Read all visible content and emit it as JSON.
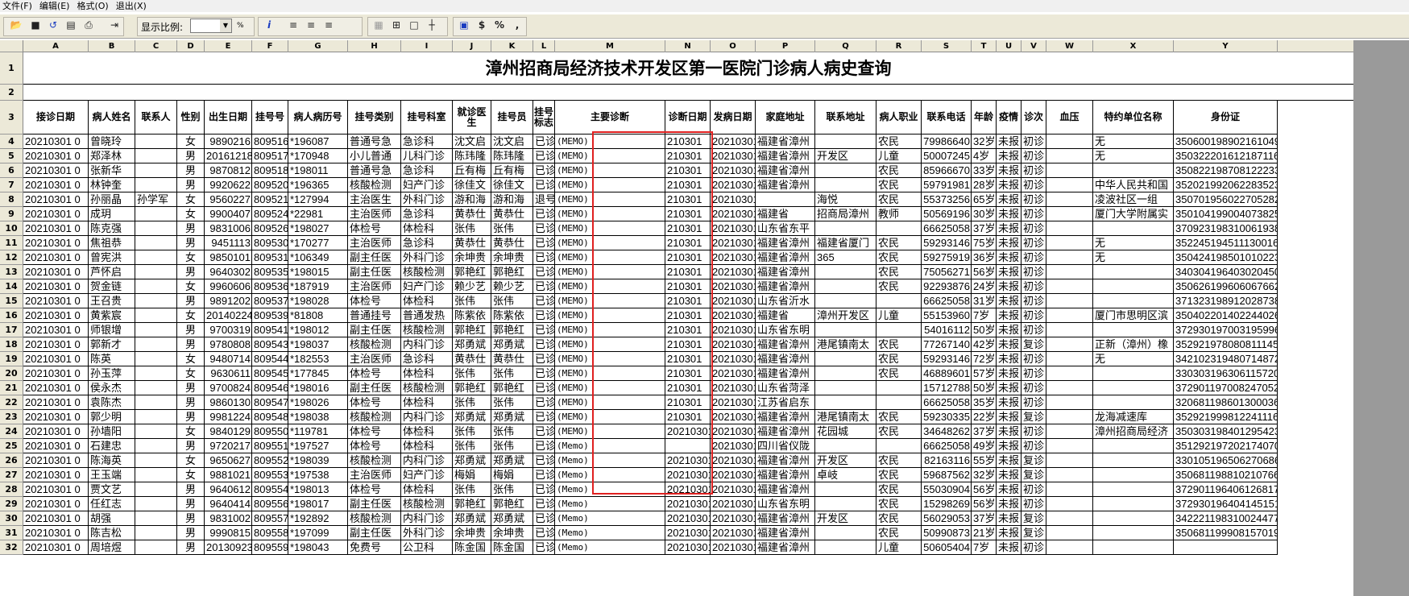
{
  "menu": [
    "文件(F)",
    "编辑(E)",
    "格式(O)",
    "退出(X)"
  ],
  "toolbar": {
    "zoom_label": "显示比例:",
    "zoom_value": "",
    "pct": "%",
    "info": "i",
    "dollar": "$",
    "percent": "%",
    "comma": ","
  },
  "columns": [
    "A",
    "B",
    "C",
    "D",
    "E",
    "F",
    "G",
    "H",
    "I",
    "J",
    "K",
    "L",
    "M",
    "N",
    "O",
    "P",
    "Q",
    "R",
    "S",
    "T",
    "U",
    "V",
    "W",
    "X",
    "Y"
  ],
  "title": "漳州招商局经济技术开发区第一医院门诊病人病史查询",
  "headers": [
    "接诊日期",
    "病人姓名",
    "联系人",
    "性别",
    "出生日期",
    "挂号号",
    "病人病历号",
    "挂号类别",
    "挂号科室",
    "就诊医生",
    "挂号员",
    "挂号标志",
    "主要诊断",
    "诊断日期",
    "发病日期",
    "家庭地址",
    "联系地址",
    "病人职业",
    "联系电话",
    "年龄",
    "疫情",
    "诊次",
    "血压",
    "特约单位名称",
    "身份证"
  ],
  "colors": {
    "highlight": "#e02020",
    "header_bg": "#ece9d8",
    "scroll": "#9a9a9a"
  },
  "rows": [
    [
      "4",
      "20210301 0",
      "曾晓玲",
      "",
      "女",
      "9890216",
      "809516",
      "*196087",
      "普通号急",
      "急诊科",
      "沈文启",
      "沈文启",
      "已诊",
      "(MEMO)",
      "210301",
      "20210301",
      "福建省漳州",
      "",
      "农民",
      "79986640",
      "32岁",
      "未报",
      "初诊",
      "",
      "无",
      "3506001989021610491"
    ],
    [
      "5",
      "20210301 0",
      "郑泽林",
      "",
      "男",
      "20161218",
      "809517",
      "*170948",
      "小儿普通",
      "儿科门诊",
      "陈玮隆",
      "陈玮隆",
      "已诊",
      "(MEMO)",
      "210301",
      "20210301",
      "福建省漳州",
      "开发区",
      "儿童",
      "50007245",
      "4岁",
      "未报",
      "初诊",
      "",
      "无",
      "350322201612187116"
    ],
    [
      "6",
      "20210301 0",
      "张新华",
      "",
      "男",
      "9870812",
      "809518",
      "*198011",
      "普通号急",
      "急诊科",
      "丘有梅",
      "丘有梅",
      "已诊",
      "(MEMO)",
      "210301",
      "20210301",
      "福建省漳州",
      "",
      "农民",
      "85966670",
      "33岁",
      "未报",
      "初诊",
      "",
      "",
      "350822198708122233"
    ],
    [
      "7",
      "20210301 0",
      "林钟奎",
      "",
      "男",
      "9920622",
      "809520",
      "*196365",
      "核酸检测",
      "妇产门诊",
      "徐佳文",
      "徐佳文",
      "已诊",
      "(MEMO)",
      "210301",
      "20210301",
      "福建省漳州",
      "",
      "农民",
      "59791981",
      "28岁",
      "未报",
      "初诊",
      "",
      "中华人民共和国",
      "352021992062283523"
    ],
    [
      "8",
      "20210301 0",
      "孙丽晶",
      "孙学军",
      "女",
      "9560227",
      "809521",
      "*127994",
      "主治医生",
      "外科门诊",
      "游和海",
      "游和海",
      "退号",
      "(MEMO)",
      "210301",
      "20210301",
      "",
      "海悦",
      "农民",
      "55373256",
      "65岁",
      "未报",
      "初诊",
      "",
      "凌波社区一组",
      "350701956022705282"
    ],
    [
      "9",
      "20210301 0",
      "成玥",
      "",
      "女",
      "9900407",
      "809524",
      "*22981",
      "主治医师",
      "急诊科",
      "黄恭仕",
      "黄恭仕",
      "已诊",
      "(MEMO)",
      "210301",
      "20210301",
      "福建省",
      "招商局漳州",
      "教师",
      "50569196",
      "30岁",
      "未报",
      "初诊",
      "",
      "厦门大学附属实",
      "350104199004073825"
    ],
    [
      "10",
      "20210301 0",
      "陈克强",
      "",
      "男",
      "9831006",
      "809526",
      "*198027",
      "体检号",
      "体检科",
      "张伟",
      "张伟",
      "已诊",
      "(MEMO)",
      "210301",
      "20210301",
      "山东省东平",
      "",
      "",
      "66625058",
      "37岁",
      "未报",
      "初诊",
      "",
      "",
      "370923198310061938"
    ],
    [
      "11",
      "20210301 0",
      "焦祖恭",
      "",
      "男",
      "9451113",
      "809530",
      "*170277",
      "主治医师",
      "急诊科",
      "黄恭仕",
      "黄恭仕",
      "已诊",
      "(MEMO)",
      "210301",
      "20210301",
      "福建省漳州",
      "福建省厦门",
      "农民",
      "59293146",
      "75岁",
      "未报",
      "初诊",
      "",
      "无",
      "352245194511130016"
    ],
    [
      "12",
      "20210301 0",
      "曾宪洪",
      "",
      "女",
      "9850101",
      "809531",
      "*106349",
      "副主任医",
      "外科门诊",
      "余坤贵",
      "余坤贵",
      "已诊",
      "(MEMO)",
      "210301",
      "20210301",
      "福建省漳州",
      "365",
      "农民",
      "59275919",
      "36岁",
      "未报",
      "初诊",
      "",
      "无",
      "350424198501010223"
    ],
    [
      "13",
      "20210301 0",
      "芦怀启",
      "",
      "男",
      "9640302",
      "809535",
      "*198015",
      "副主任医",
      "核酸检测",
      "郭艳红",
      "郭艳红",
      "已诊",
      "(MEMO)",
      "210301",
      "20210301",
      "福建省漳州",
      "",
      "农民",
      "75056271",
      "56岁",
      "未报",
      "初诊",
      "",
      "",
      "340304196403020450"
    ],
    [
      "14",
      "20210301 0",
      "贺金链",
      "",
      "女",
      "9960606",
      "809536",
      "*187919",
      "主治医师",
      "妇产门诊",
      "赖少艺",
      "赖少艺",
      "已诊",
      "(MEMO)",
      "210301",
      "20210301",
      "福建省漳州",
      "",
      "农民",
      "92293876",
      "24岁",
      "未报",
      "初诊",
      "",
      "",
      "350626199606067662"
    ],
    [
      "15",
      "20210301 0",
      "王召贵",
      "",
      "男",
      "9891202",
      "809537",
      "*198028",
      "体检号",
      "体检科",
      "张伟",
      "张伟",
      "已诊",
      "(MEMO)",
      "210301",
      "20210301",
      "山东省沂水",
      "",
      "",
      "66625058",
      "31岁",
      "未报",
      "初诊",
      "",
      "",
      "371323198912028738"
    ],
    [
      "16",
      "20210301 0",
      "黄紫宸",
      "",
      "女",
      "20140224",
      "809539",
      "*81808",
      "普通挂号",
      "普通发热",
      "陈紫依",
      "陈紫依",
      "已诊",
      "(MEMO)",
      "210301",
      "20210301",
      "福建省",
      "漳州开发区",
      "儿童",
      "55153960",
      "7岁",
      "未报",
      "初诊",
      "",
      "厦门市思明区滨",
      "350402201402244026"
    ],
    [
      "17",
      "20210301 0",
      "师银增",
      "",
      "男",
      "9700319",
      "809541",
      "*198012",
      "副主任医",
      "核酸检测",
      "郭艳红",
      "郭艳红",
      "已诊",
      "(MEMO)",
      "210301",
      "20210301",
      "山东省东明",
      "",
      "",
      "54016112",
      "50岁",
      "未报",
      "初诊",
      "",
      "",
      "372930197003195996"
    ],
    [
      "18",
      "20210301 0",
      "郭新才",
      "",
      "男",
      "9780808",
      "809543",
      "*198037",
      "核酸检测",
      "内科门诊",
      "郑勇斌",
      "郑勇斌",
      "已诊",
      "(MEMO)",
      "210301",
      "20210301",
      "福建省漳州",
      "港尾镇南太",
      "农民",
      "77267140",
      "42岁",
      "未报",
      "复诊",
      "",
      "正新（漳州）橡",
      "352921978080811145"
    ],
    [
      "19",
      "20210301 0",
      "陈英",
      "",
      "女",
      "9480714",
      "809544",
      "*182553",
      "主治医师",
      "急诊科",
      "黄恭仕",
      "黄恭仕",
      "已诊",
      "(MEMO)",
      "210301",
      "20210301",
      "福建省漳州",
      "",
      "农民",
      "59293146",
      "72岁",
      "未报",
      "初诊",
      "",
      "无",
      "342102319480714872"
    ],
    [
      "20",
      "20210301 0",
      "孙玉萍",
      "",
      "女",
      "9630611",
      "809545",
      "*177845",
      "体检号",
      "体检科",
      "张伟",
      "张伟",
      "已诊",
      "(MEMO)",
      "210301",
      "20210301",
      "福建省漳州",
      "",
      "农民",
      "46889601",
      "57岁",
      "未报",
      "初诊",
      "",
      "",
      "330303196306115720"
    ],
    [
      "21",
      "20210301 0",
      "侯永杰",
      "",
      "男",
      "9700824",
      "809546",
      "*198016",
      "副主任医",
      "核酸检测",
      "郭艳红",
      "郭艳红",
      "已诊",
      "(MEMO)",
      "210301",
      "20210301",
      "山东省菏泽",
      "",
      "",
      "15712788",
      "50岁",
      "未报",
      "初诊",
      "",
      "",
      "372901197008247052"
    ],
    [
      "22",
      "20210301 0",
      "袁陈杰",
      "",
      "男",
      "9860130",
      "809547",
      "*198026",
      "体检号",
      "体检科",
      "张伟",
      "张伟",
      "已诊",
      "(MEMO)",
      "210301",
      "20210301",
      "江苏省启东",
      "",
      "",
      "66625058",
      "35岁",
      "未报",
      "初诊",
      "",
      "",
      "320681198601300036"
    ],
    [
      "23",
      "20210301 0",
      "郭少明",
      "",
      "男",
      "9981224",
      "809548",
      "*198038",
      "核酸检测",
      "内科门诊",
      "郑勇斌",
      "郑勇斌",
      "已诊",
      "(MEMO)",
      "210301",
      "20210301",
      "福建省漳州",
      "港尾镇南太",
      "农民",
      "59230335",
      "22岁",
      "未报",
      "复诊",
      "",
      "龙海减速库",
      "352921999812241116"
    ],
    [
      "24",
      "20210301 0",
      "孙墙阳",
      "",
      "女",
      "9840129",
      "809550",
      "*119781",
      "体检号",
      "体检科",
      "张伟",
      "张伟",
      "已诊",
      "(MEMO)",
      "20210301",
      "20210301",
      "福建省漳州",
      "花园城",
      "农民",
      "34648262",
      "37岁",
      "未报",
      "初诊",
      "",
      "漳州招商局经济",
      "350303198401295423"
    ],
    [
      "25",
      "20210301 0",
      "石建忠",
      "",
      "男",
      "9720217",
      "809551",
      "*197527",
      "体检号",
      "体检科",
      "张伟",
      "张伟",
      "已诊",
      "(Memo)",
      "",
      "20210301",
      "四川省仪陇",
      "",
      "",
      "66625058",
      "49岁",
      "未报",
      "初诊",
      "",
      "",
      "351292197202174070"
    ],
    [
      "26",
      "20210301 0",
      "陈海英",
      "",
      "女",
      "9650627",
      "809552",
      "*198039",
      "核酸检测",
      "内科门诊",
      "郑勇斌",
      "郑勇斌",
      "已诊",
      "(Memo)",
      "20210301",
      "20210301",
      "福建省漳州",
      "开发区",
      "农民",
      "82163116",
      "55岁",
      "未报",
      "复诊",
      "",
      "",
      "330105196506270686"
    ],
    [
      "27",
      "20210301 0",
      "王玉端",
      "",
      "女",
      "9881021",
      "809553",
      "*197538",
      "主治医师",
      "妇产门诊",
      "梅娟",
      "梅娟",
      "已诊",
      "(Memo)",
      "20210301",
      "20210301",
      "福建省漳州",
      "卓岐",
      "农民",
      "59687562",
      "32岁",
      "未报",
      "复诊",
      "",
      "",
      "350681198810210766"
    ],
    [
      "28",
      "20210301 0",
      "贾文艺",
      "",
      "男",
      "9640612",
      "809554",
      "*198013",
      "体检号",
      "体检科",
      "张伟",
      "张伟",
      "已诊",
      "(Memo)",
      "20210301",
      "20210301",
      "福建省漳州",
      "",
      "农民",
      "55030904",
      "56岁",
      "未报",
      "初诊",
      "",
      "",
      "372901196406126817"
    ],
    [
      "29",
      "20210301 0",
      "任红志",
      "",
      "男",
      "9640414",
      "809556",
      "*198017",
      "副主任医",
      "核酸检测",
      "郭艳红",
      "郭艳红",
      "已诊",
      "(Memo)",
      "20210301",
      "20210301",
      "山东省东明",
      "",
      "农民",
      "15298269",
      "56岁",
      "未报",
      "初诊",
      "",
      "",
      "372930196404145151"
    ],
    [
      "30",
      "20210301 0",
      "胡强",
      "",
      "男",
      "9831002",
      "809557",
      "*192892",
      "核酸检测",
      "内科门诊",
      "郑勇斌",
      "郑勇斌",
      "已诊",
      "(Memo)",
      "20210301",
      "20210301",
      "福建省漳州",
      "开发区",
      "农民",
      "56029053",
      "37岁",
      "未报",
      "复诊",
      "",
      "",
      "342221198310024477"
    ],
    [
      "31",
      "20210301 0",
      "陈吉松",
      "",
      "男",
      "9990815",
      "809558",
      "*197099",
      "副主任医",
      "外科门诊",
      "余坤贵",
      "余坤贵",
      "已诊",
      "(Memo)",
      "20210301",
      "20210301",
      "福建省漳州",
      "",
      "农民",
      "50990873",
      "21岁",
      "未报",
      "复诊",
      "",
      "",
      "350681199908157019"
    ],
    [
      "32",
      "20210301 0",
      "周培煜",
      "",
      "男",
      "20130923",
      "809559",
      "*198043",
      "免费号",
      "公卫科",
      "陈金国",
      "陈金国",
      "已诊",
      "(Memo)",
      "20210301",
      "20210301",
      "福建省漳州",
      "",
      "儿童",
      "50605404",
      "7岁",
      "未报",
      "初诊",
      "",
      "",
      ""
    ]
  ]
}
